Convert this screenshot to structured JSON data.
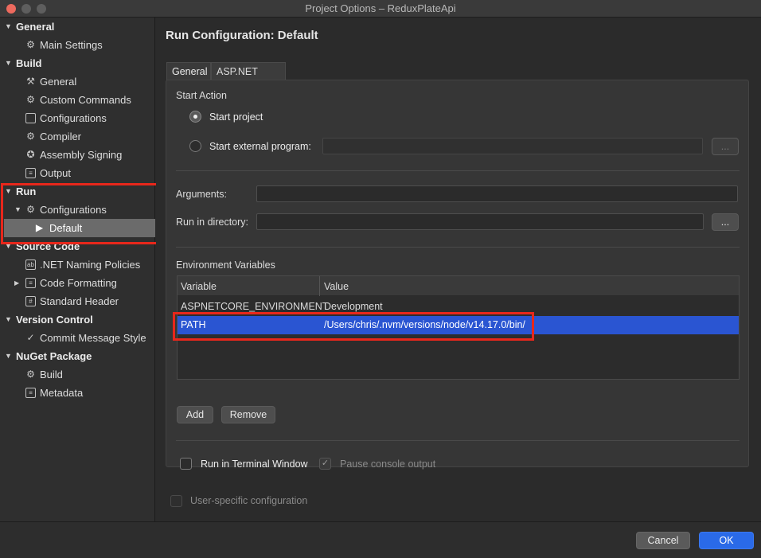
{
  "window": {
    "title": "Project Options – ReduxPlateApi"
  },
  "sidebar": {
    "sections": [
      {
        "label": "General",
        "items": [
          {
            "label": "Main Settings",
            "icon": "gear-icon"
          }
        ]
      },
      {
        "label": "Build",
        "items": [
          {
            "label": "General",
            "icon": "hammer-icon"
          },
          {
            "label": "Custom Commands",
            "icon": "gear-icon"
          },
          {
            "label": "Configurations",
            "icon": "window-icon"
          },
          {
            "label": "Compiler",
            "icon": "compiler-icon"
          },
          {
            "label": "Assembly Signing",
            "icon": "badge-icon"
          },
          {
            "label": "Output",
            "icon": "document-icon"
          }
        ]
      },
      {
        "label": "Run",
        "items": [
          {
            "label": "Configurations",
            "icon": "gear-icon"
          },
          {
            "label": "Default",
            "icon": "play-icon",
            "selected": true
          }
        ]
      },
      {
        "label": "Source Code",
        "items": [
          {
            "label": ".NET Naming Policies",
            "icon": "naming-icon"
          },
          {
            "label": "Code Formatting",
            "icon": "code-format-icon"
          },
          {
            "label": "Standard Header",
            "icon": "header-icon"
          }
        ]
      },
      {
        "label": "Version Control",
        "items": [
          {
            "label": "Commit Message Style",
            "icon": "commit-icon"
          }
        ]
      },
      {
        "label": "NuGet Package",
        "items": [
          {
            "label": "Build",
            "icon": "gear-icon"
          },
          {
            "label": "Metadata",
            "icon": "document-icon"
          }
        ]
      }
    ]
  },
  "main": {
    "title": "Run Configuration: Default",
    "tabs": [
      {
        "label": "General",
        "active": true
      },
      {
        "label": "ASP.NET Core",
        "active": false
      }
    ],
    "start_action": {
      "label": "Start Action",
      "options": [
        {
          "label": "Start project",
          "selected": true
        },
        {
          "label": "Start external program:",
          "selected": false
        }
      ],
      "external_program_value": "",
      "browse_label": "..."
    },
    "arguments": {
      "label": "Arguments:",
      "value": ""
    },
    "run_in_directory": {
      "label": "Run in directory:",
      "value": "",
      "browse_label": "..."
    },
    "environment": {
      "label": "Environment Variables",
      "columns": [
        "Variable",
        "Value"
      ],
      "rows": [
        {
          "variable": "ASPNETCORE_ENVIRONMENT",
          "value": "Development",
          "selected": false
        },
        {
          "variable": "PATH",
          "value": "/Users/chris/.nvm/versions/node/v14.17.0/bin/",
          "selected": true
        }
      ],
      "add_label": "Add",
      "remove_label": "Remove"
    },
    "run_in_terminal": {
      "label": "Run in Terminal Window",
      "checked": false
    },
    "pause_console": {
      "label": "Pause console output",
      "checked": true,
      "enabled": false
    },
    "user_specific": {
      "label": "User-specific configuration",
      "checked": false,
      "enabled": false
    }
  },
  "footer": {
    "cancel_label": "Cancel",
    "ok_label": "OK"
  },
  "colors": {
    "selection": "#2a55d2",
    "ok_button": "#2a6ae8",
    "highlight_box": "#e8271b"
  }
}
